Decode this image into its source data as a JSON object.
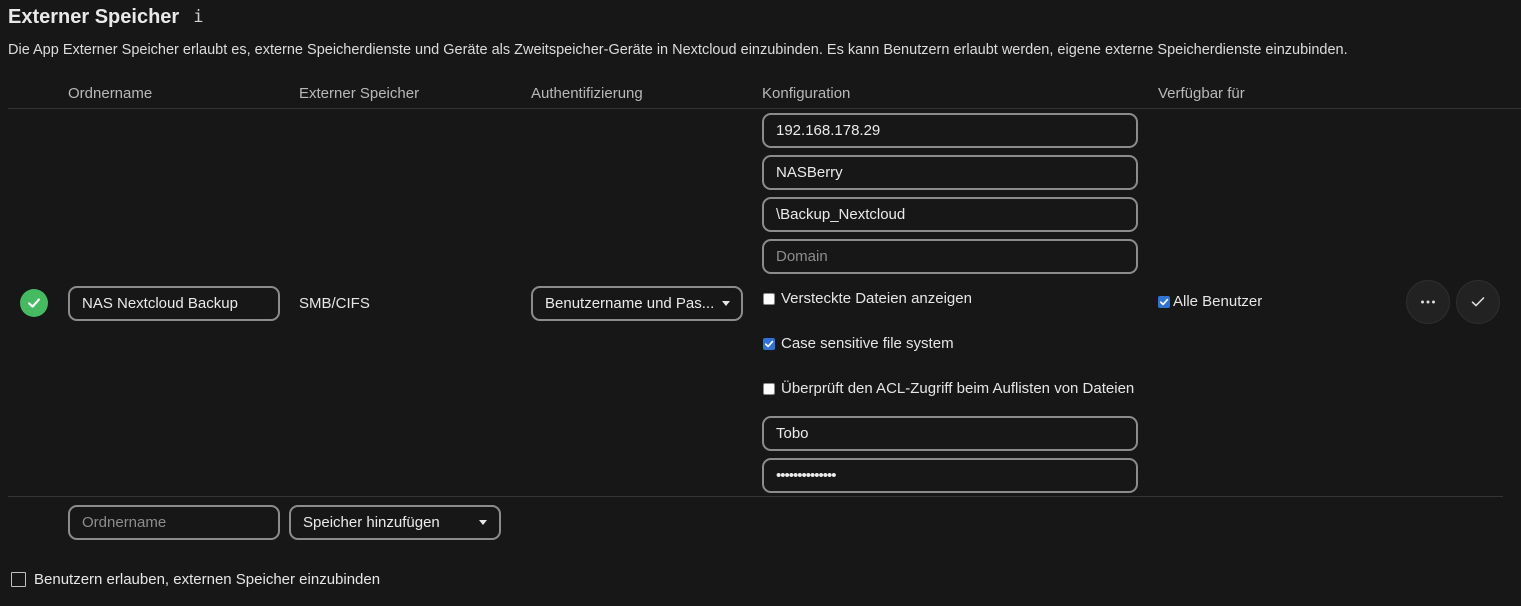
{
  "header": {
    "title": "Externer Speicher",
    "info_icon": "i",
    "description": "Die App Externer Speicher erlaubt es, externe Speicherdienste und Geräte als Zweitspeicher-Geräte in Nextcloud einzubinden. Es kann Benutzern erlaubt werden, eigene externe Speicherdienste einzubinden."
  },
  "table": {
    "columns": {
      "folder_name": "Ordnername",
      "external_storage": "Externer Speicher",
      "authentication": "Authentifizierung",
      "configuration": "Konfiguration",
      "available_for": "Verfügbar für"
    },
    "mount": {
      "status": "ok",
      "status_color": "#46ba61",
      "folder_name": "NAS Nextcloud Backup",
      "backend": "SMB/CIFS",
      "auth_method": "Benutzername und Pas...",
      "config": {
        "host": "192.168.178.29",
        "share": "NASBerry",
        "remote_subfolder": "\\Backup_Nextcloud",
        "domain_value": "",
        "domain_placeholder": "Domain",
        "show_hidden": {
          "label": "Versteckte Dateien anzeigen",
          "checked": false
        },
        "case_sensitive": {
          "label": "Case sensitive file system",
          "checked": true
        },
        "check_acl": {
          "label": "Überprüft den ACL-Zugriff beim Auflisten von Dateien",
          "checked": false
        },
        "user": "Tobo",
        "password_mask": "••••••••••••••"
      },
      "applicable": {
        "label": "Alle Benutzer",
        "checked": true
      },
      "actions": {
        "more_icon": "more-icon",
        "save_icon": "checkmark-icon"
      }
    },
    "add_row": {
      "folder_placeholder": "Ordnername",
      "add_storage_label": "Speicher hinzufügen"
    }
  },
  "footer": {
    "allow_user_mounting": {
      "label": "Benutzern erlauben, externen Speicher einzubinden",
      "checked": false
    }
  },
  "colors": {
    "background": "#171717",
    "accent": "#2f74d0",
    "success": "#46ba61"
  }
}
